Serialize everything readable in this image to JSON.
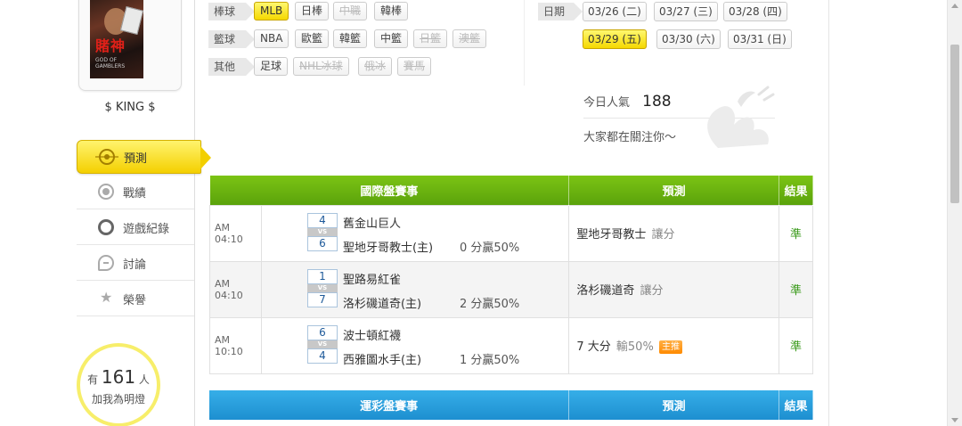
{
  "profile": {
    "avatar_title": "賭神",
    "avatar_subtitle": "GOD OF GAMBLERS",
    "username": "$ KING $"
  },
  "sidebar": {
    "items": [
      {
        "label": "預測",
        "icon": "target-icon",
        "active": true
      },
      {
        "label": "戰績",
        "icon": "record-icon"
      },
      {
        "label": "遊戲紀錄",
        "icon": "ring-icon"
      },
      {
        "label": "討論",
        "icon": "chat-icon"
      },
      {
        "label": "榮譽",
        "icon": "medal-icon"
      }
    ]
  },
  "fans": {
    "prefix": "有",
    "count": "161",
    "suffix": "人",
    "line2": "加我為明燈"
  },
  "filters": {
    "baseball": {
      "label": "棒球",
      "chips": [
        {
          "label": "MLB",
          "state": "active"
        },
        {
          "label": "日棒",
          "state": "normal"
        },
        {
          "label": "中職",
          "state": "disabled"
        },
        {
          "label": "韓棒",
          "state": "normal"
        }
      ]
    },
    "basketball": {
      "label": "籃球",
      "chips": [
        {
          "label": "NBA",
          "state": "normal"
        },
        {
          "label": "歐籃",
          "state": "normal"
        },
        {
          "label": "韓籃",
          "state": "normal"
        },
        {
          "label": "中籃",
          "state": "normal"
        },
        {
          "label": "日籃",
          "state": "disabled"
        },
        {
          "label": "澳籃",
          "state": "disabled"
        }
      ]
    },
    "other": {
      "label": "其他",
      "chips": [
        {
          "label": "足球",
          "state": "normal"
        },
        {
          "label": "NHL冰球",
          "state": "disabled"
        },
        {
          "label": "俄冰",
          "state": "disabled"
        },
        {
          "label": "賽馬",
          "state": "disabled"
        }
      ]
    }
  },
  "dates": {
    "label": "日期",
    "items": [
      "03/26 (二)",
      "03/27 (三)",
      "03/28 (四)",
      "03/29 (五)",
      "03/30 (六)",
      "03/31 (日)"
    ],
    "active_index": 3
  },
  "stats": {
    "popularity_label": "今日人氣",
    "popularity_value": "188",
    "attention_text": "大家都在關注你～"
  },
  "international": {
    "headers": [
      "國際盤賽事",
      "預測",
      "結果"
    ],
    "rows": [
      {
        "time": "AM 04:10",
        "score_away": "4",
        "score_home": "6",
        "team_away": "舊金山巨人",
        "team_home": "聖地牙哥教士(主)",
        "handicap": "0 分贏50%",
        "pred_main": "聖地牙哥教士",
        "pred_sub": "讓分",
        "badge": "",
        "result": "準"
      },
      {
        "time": "AM 04:10",
        "score_away": "1",
        "score_home": "7",
        "team_away": "聖路易紅雀",
        "team_home": "洛杉磯道奇(主)",
        "handicap": "2 分贏50%",
        "pred_main": "洛杉磯道奇",
        "pred_sub": "讓分",
        "badge": "",
        "result": "準"
      },
      {
        "time": "AM 10:10",
        "score_away": "6",
        "score_home": "4",
        "team_away": "波士頓紅襪",
        "team_home": "西雅圖水手(主)",
        "handicap": "1 分贏50%",
        "pred_main": "7 大分",
        "pred_sub": "輸50%",
        "badge": "主推",
        "result": "準"
      }
    ]
  },
  "lottery": {
    "headers": [
      "運彩盤賽事",
      "預測",
      "結果"
    ]
  },
  "vs_label": "VS",
  "colors": {
    "green_header": "#6bb310",
    "blue_header": "#2a9fdd",
    "active_chip": "#f5d800",
    "win": "#3a9a1a",
    "badge": "#ff8a00"
  }
}
